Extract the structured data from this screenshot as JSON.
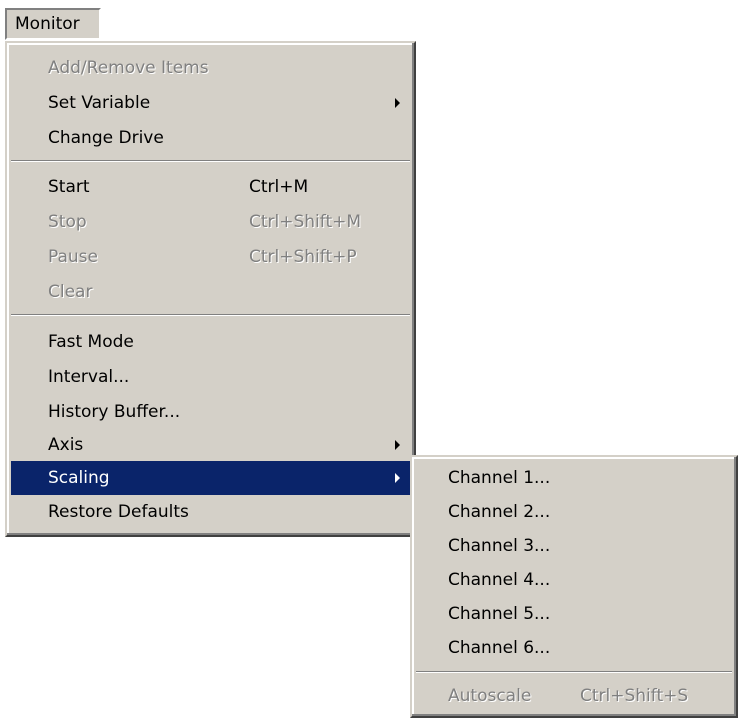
{
  "menubar": {
    "monitor_label": "Monitor"
  },
  "monitor_menu": {
    "items": [
      {
        "label": "Add/Remove Items",
        "shortcut": "",
        "disabled": true
      },
      {
        "label": "Set Variable",
        "shortcut": "",
        "submenu": true
      },
      {
        "label": "Change Drive",
        "shortcut": ""
      },
      {
        "label": "Start",
        "shortcut": "Ctrl+M"
      },
      {
        "label": "Stop",
        "shortcut": "Ctrl+Shift+M",
        "disabled": true
      },
      {
        "label": "Pause",
        "shortcut": "Ctrl+Shift+P",
        "disabled": true
      },
      {
        "label": "Clear",
        "shortcut": "",
        "disabled": true
      },
      {
        "label": "Fast Mode",
        "shortcut": ""
      },
      {
        "label": "Interval...",
        "shortcut": ""
      },
      {
        "label": "History Buffer...",
        "shortcut": ""
      },
      {
        "label": "Axis",
        "shortcut": "",
        "submenu": true
      },
      {
        "label": "Scaling",
        "shortcut": "",
        "submenu": true,
        "highlighted": true
      },
      {
        "label": "Restore Defaults",
        "shortcut": ""
      }
    ]
  },
  "scaling_menu": {
    "items": [
      {
        "label": "Channel 1..."
      },
      {
        "label": "Channel 2..."
      },
      {
        "label": "Channel 3..."
      },
      {
        "label": "Channel 4..."
      },
      {
        "label": "Channel 5..."
      },
      {
        "label": "Channel 6..."
      },
      {
        "label": "Autoscale",
        "shortcut": "Ctrl+Shift+S",
        "disabled": true
      }
    ]
  },
  "colors": {
    "menu_face": "#d4d0c8",
    "highlight": "#0a246a",
    "disabled_text": "#808080"
  }
}
